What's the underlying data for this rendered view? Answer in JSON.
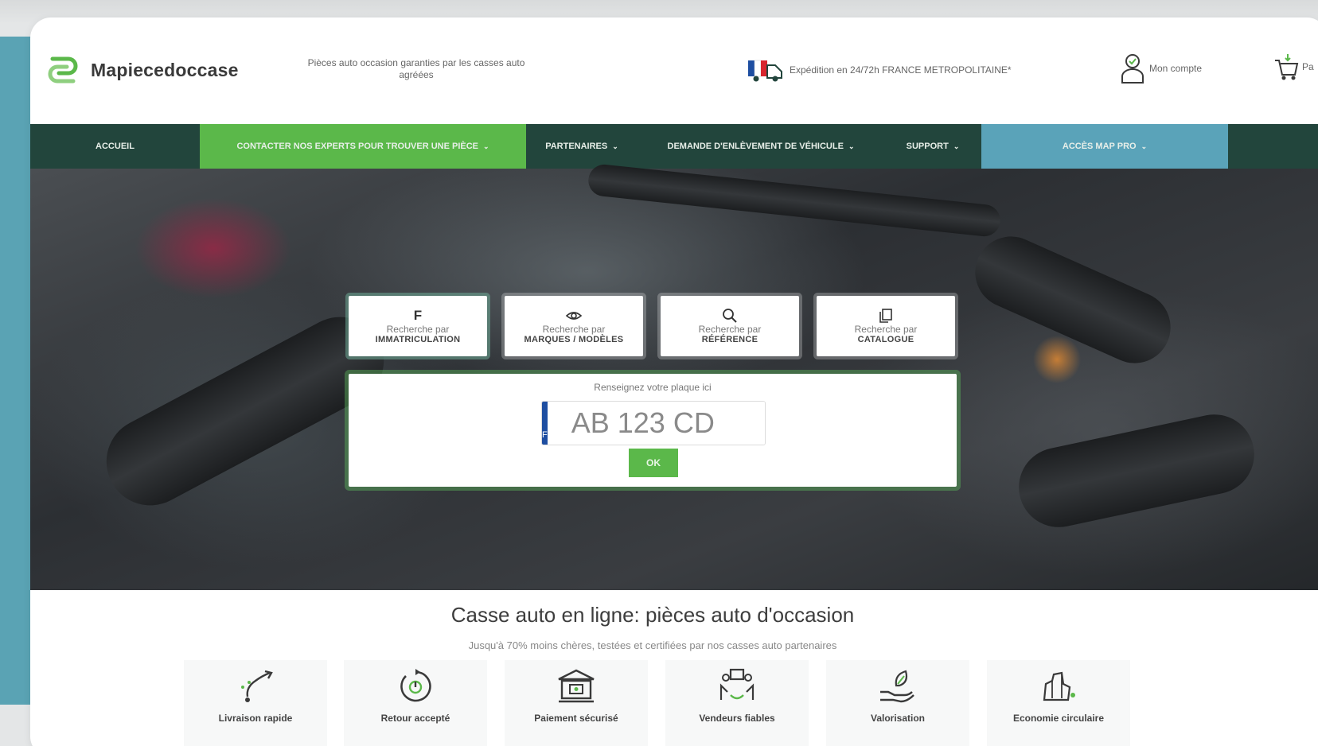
{
  "header": {
    "logo_text": "Mapiecedoccase",
    "tagline": "Pièces auto occasion garanties par les casses auto agréées",
    "shipping_text": "Expédition en 24/72h FRANCE METROPOLITAINE*",
    "account_label": "Mon compte",
    "cart_label": "Pa"
  },
  "nav": {
    "items": [
      {
        "label": "Accueil",
        "dropdown": false
      },
      {
        "label": "Contacter nos experts pour trouver une pièce",
        "dropdown": true
      },
      {
        "label": "Partenaires",
        "dropdown": true
      },
      {
        "label": "Demande d'enlèvement de véhicule",
        "dropdown": true
      },
      {
        "label": "Support",
        "dropdown": true
      },
      {
        "label": "Accès MAP PRO",
        "dropdown": true
      }
    ],
    "chevron": "⌄"
  },
  "search": {
    "tabs": [
      {
        "glyph": "F",
        "line1": "Recherche par",
        "line2": "IMMATRICULATION",
        "icon": "plate-letter-icon"
      },
      {
        "glyph": "",
        "line1": "Recherche par",
        "line2": "MARQUES / MODÈLES",
        "icon": "eye-icon"
      },
      {
        "glyph": "",
        "line1": "Recherche par",
        "line2": "RÉFÉRENCE",
        "icon": "search-icon"
      },
      {
        "glyph": "",
        "line1": "Recherche par",
        "line2": "CATALOGUE",
        "icon": "copy-icon"
      }
    ],
    "prompt": "Renseignez votre plaque ici",
    "plate_country": "F",
    "plate_placeholder": "AB 123 CD",
    "plate_value": "",
    "ok_label": "OK"
  },
  "main": {
    "heading": "Casse auto en ligne: pièces auto d'occasion",
    "subheading": "Jusqu'à 70% moins chères, testées et certifiées par nos casses auto partenaires"
  },
  "features": [
    {
      "label": "Livraison rapide",
      "icon": "fast-delivery-icon"
    },
    {
      "label": "Retour accepté",
      "icon": "return-icon"
    },
    {
      "label": "Paiement sécurisé",
      "icon": "bank-icon"
    },
    {
      "label": "Vendeurs fiables",
      "icon": "trusted-sellers-icon"
    },
    {
      "label": "Valorisation",
      "icon": "hand-leaf-icon"
    },
    {
      "label": "Economie circulaire",
      "icon": "circular-economy-icon"
    }
  ],
  "colors": {
    "nav_bg": "#22453c",
    "accent_green": "#5bb84a",
    "accent_blue": "#5aa3b9",
    "eu_blue": "#1e4ea1"
  }
}
